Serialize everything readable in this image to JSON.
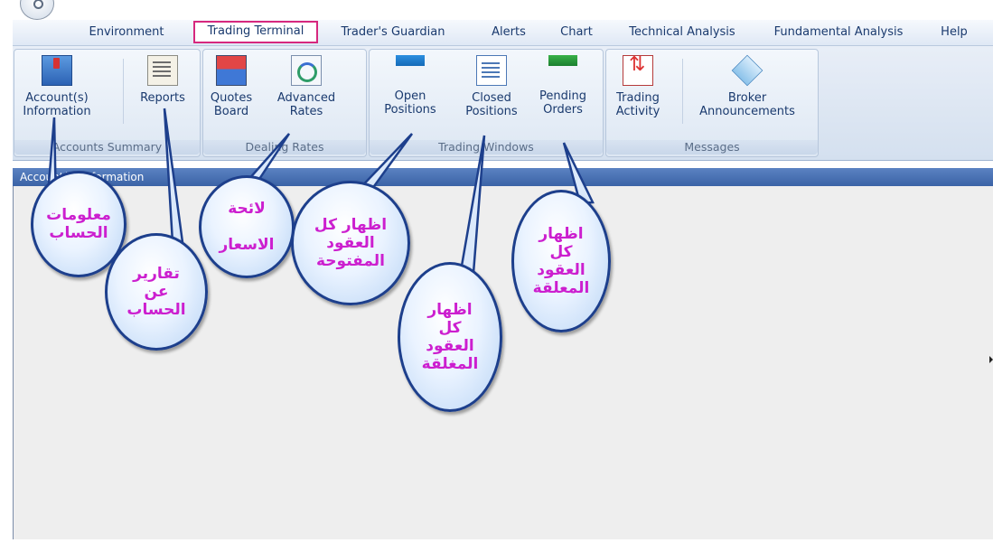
{
  "menu": {
    "tabs": [
      {
        "label": "Environment"
      },
      {
        "label": "Trading Terminal"
      },
      {
        "label": "Trader's Guardian"
      },
      {
        "label": "Alerts"
      },
      {
        "label": "Chart"
      },
      {
        "label": "Technical Analysis"
      },
      {
        "label": "Fundamental Analysis"
      },
      {
        "label": "Help"
      }
    ],
    "active_tab": "Trading Terminal",
    "active_highlight_color": "#d6287e"
  },
  "ribbon": {
    "groups": [
      {
        "label": "Accounts Summary",
        "buttons": [
          {
            "line1": "Account(s)",
            "line2": "Information",
            "icon": "account-info-icon"
          },
          {
            "line1": "Reports",
            "line2": "",
            "icon": "reports-icon"
          }
        ]
      },
      {
        "label": "Dealing Rates",
        "buttons": [
          {
            "line1": "Quotes",
            "line2": "Board",
            "icon": "quotes-board-icon"
          },
          {
            "line1": "Advanced",
            "line2": "Rates",
            "icon": "advanced-rates-icon"
          }
        ]
      },
      {
        "label": "Trading Windows",
        "buttons": [
          {
            "line1": "Open",
            "line2": "Positions",
            "icon": "open-positions-icon"
          },
          {
            "line1": "Closed",
            "line2": "Positions",
            "icon": "closed-positions-icon"
          },
          {
            "line1": "Pending",
            "line2": "Orders",
            "icon": "pending-orders-icon"
          }
        ]
      },
      {
        "label": "Messages",
        "buttons": [
          {
            "line1": "Trading",
            "line2": "Activity",
            "icon": "trading-activity-icon"
          },
          {
            "line1": "Broker",
            "line2": "Announcements",
            "icon": "broker-announcements-icon"
          }
        ]
      }
    ]
  },
  "document_tab": {
    "label": "Account(s) Information"
  },
  "callouts": [
    {
      "text": "معلومات\nالحساب"
    },
    {
      "text": "تقارير\nعن\nالحساب"
    },
    {
      "text": "لائحة\n\nالاسعار"
    },
    {
      "text": "اظهار كل\nالعقود\nالمفتوحة"
    },
    {
      "text": "اظهار\nكل\nالعقود\nالمغلقة"
    },
    {
      "text": "اظهار\nكل\nالعقود\nالمعلقة"
    }
  ],
  "callout_text_color": "#cc1fcf",
  "callout_border_color": "#1d3f8c"
}
